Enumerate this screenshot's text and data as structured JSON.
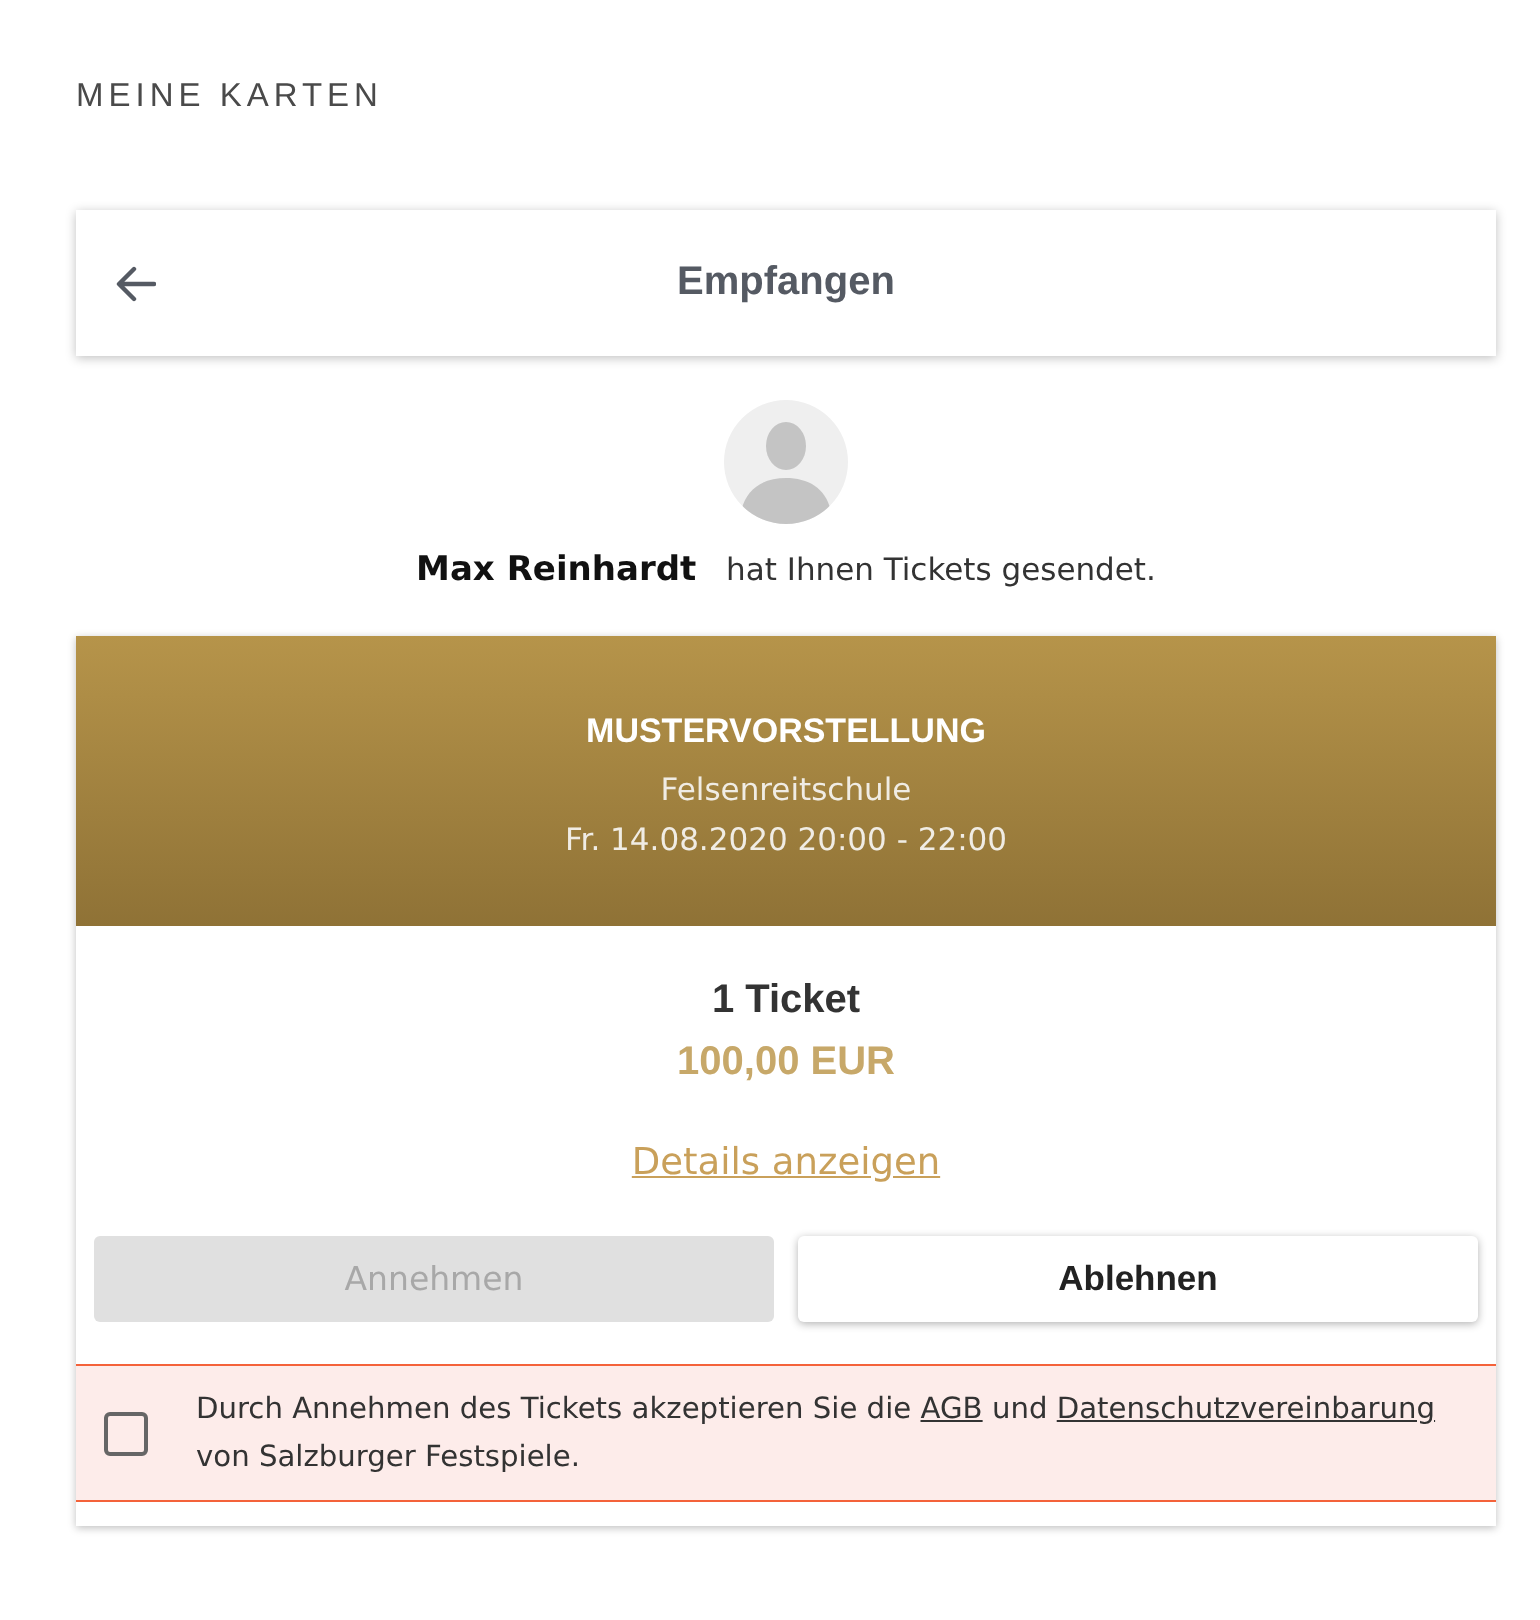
{
  "page_title": "MEINE KARTEN",
  "header": {
    "title": "Empfangen"
  },
  "sender": {
    "message": "**Max Reinhardt** hat Ihnen Tickets gesendet."
  },
  "event": {
    "title": "MUSTERVORSTELLUNG",
    "venue": "Felsenreitschule",
    "datetime": "Fr. 14.08.2020 20:00 - 22:00"
  },
  "order": {
    "quantity": "1 Ticket",
    "price": "100,00 EUR",
    "details_link": "Details anzeigen"
  },
  "buttons": [
    {
      "label": "Annehmen",
      "disabled": true
    },
    {
      "label": "Ablehnen",
      "disabled": false
    }
  ],
  "consent": {
    "checked": false,
    "parts": [
      {
        "kind": "text",
        "text": "Durch Annehmen des Tickets akzeptieren Sie die"
      },
      {
        "kind": "link",
        "text": "AGB"
      },
      {
        "kind": "text",
        "text": "und"
      },
      {
        "kind": "link",
        "text": "Datenschutzvereinbarung"
      },
      {
        "kind": "text",
        "text": "von Salzburger Festspiele."
      }
    ]
  }
}
